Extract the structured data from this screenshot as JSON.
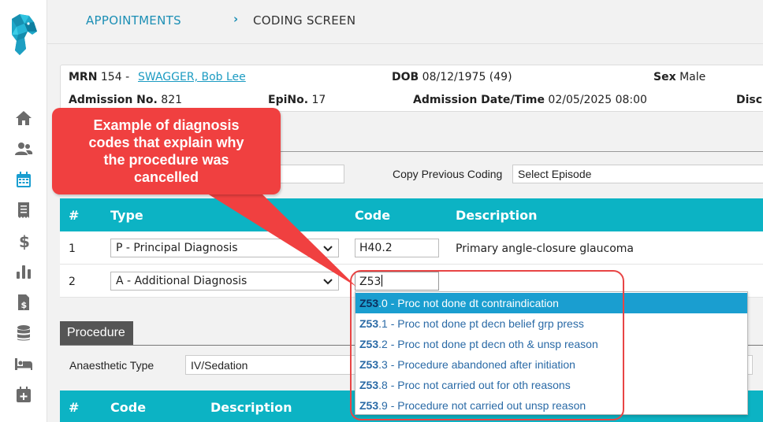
{
  "breadcrumb": {
    "parent": "APPOINTMENTS",
    "separator": "›",
    "current": "CODING SCREEN"
  },
  "patient": {
    "mrn_label": "MRN",
    "mrn_value": "154 -",
    "name": "SWAGGER, Bob Lee",
    "dob_label": "DOB",
    "dob_value": "08/12/1975 (49)",
    "sex_label": "Sex",
    "sex_value": "Male",
    "admission_label": "Admission No.",
    "admission_value": "821",
    "epino_label": "EpiNo.",
    "epino_value": "17",
    "admission_dt_label": "Admission Date/Time",
    "admission_dt_value": "02/05/2025 08:00",
    "disch_label": "Disch"
  },
  "coding": {
    "copy_label": "Copy Previous Coding",
    "episode_select": "Select Episode"
  },
  "diagnosis_table": {
    "columns": [
      "#",
      "Type",
      "Code",
      "Description"
    ],
    "rows": [
      {
        "num": "1",
        "type": "P - Principal Diagnosis",
        "code": "H40.2",
        "description": "Primary angle-closure glaucoma"
      },
      {
        "num": "2",
        "type": "A - Additional Diagnosis",
        "code": "Z53",
        "description": ""
      }
    ]
  },
  "suggestions": [
    {
      "match": "Z53",
      "rest": ".0 - Proc not done dt contraindication"
    },
    {
      "match": "Z53",
      "rest": ".1 - Proc not done pt decn belief grp press"
    },
    {
      "match": "Z53",
      "rest": ".2 - Proc not done pt decn oth & unsp reason"
    },
    {
      "match": "Z53",
      "rest": ".3 - Procedure abandoned after initiation"
    },
    {
      "match": "Z53",
      "rest": ".8 - Proc not carried out for oth reasons"
    },
    {
      "match": "Z53",
      "rest": ".9 - Procedure not carried out unsp reason"
    }
  ],
  "procedure": {
    "tab_label": "Procedure",
    "anaesthetic_label": "Anaesthetic Type",
    "anaesthetic_value": "IV/Sedation",
    "columns": [
      "#",
      "Code",
      "Description"
    ]
  },
  "callout": {
    "lines": [
      "Example of diagnosis",
      "codes that explain why",
      "the procedure was",
      "cancelled"
    ]
  },
  "colors": {
    "teal": "#0cb3c4",
    "link": "#1c9bc2",
    "callout": "#f04040",
    "highlight": "#1a9ed0",
    "nav_icon": "#6b6b6b",
    "nav_active": "#1a9ed0"
  }
}
